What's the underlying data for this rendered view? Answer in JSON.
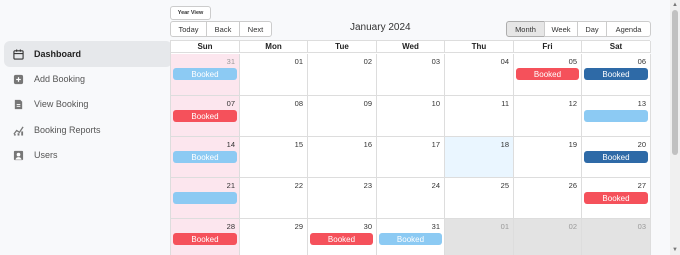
{
  "sidebar": {
    "items": [
      {
        "label": "Dashboard",
        "icon": "calendar-icon",
        "active": true
      },
      {
        "label": "Add Booking",
        "icon": "plus-square-icon",
        "active": false
      },
      {
        "label": "View Booking",
        "icon": "document-icon",
        "active": false
      },
      {
        "label": "Booking Reports",
        "icon": "chart-icon",
        "active": false
      },
      {
        "label": "Users",
        "icon": "user-icon",
        "active": false
      }
    ]
  },
  "toolbar": {
    "year_view": "Year View",
    "today": "Today",
    "back": "Back",
    "next": "Next",
    "title": "January 2024",
    "views": [
      "Month",
      "Week",
      "Day",
      "Agenda"
    ],
    "active_view": "Month"
  },
  "calendar": {
    "weekdays": [
      "Sun",
      "Mon",
      "Tue",
      "Wed",
      "Thu",
      "Fri",
      "Sat"
    ],
    "weeks": [
      [
        "31",
        "01",
        "02",
        "03",
        "04",
        "05",
        "06"
      ],
      [
        "07",
        "08",
        "09",
        "10",
        "11",
        "12",
        "13"
      ],
      [
        "14",
        "15",
        "16",
        "17",
        "18",
        "19",
        "20"
      ],
      [
        "21",
        "22",
        "23",
        "24",
        "25",
        "26",
        "27"
      ],
      [
        "28",
        "29",
        "30",
        "31",
        "01",
        "02",
        "03"
      ]
    ],
    "event_label": "Booked",
    "colors": {
      "red": "#f5515b",
      "blue": "#8ccaf3",
      "navy": "#2e6aa7",
      "sunday": "#fce6ee",
      "today": "#eaf6ff"
    }
  }
}
